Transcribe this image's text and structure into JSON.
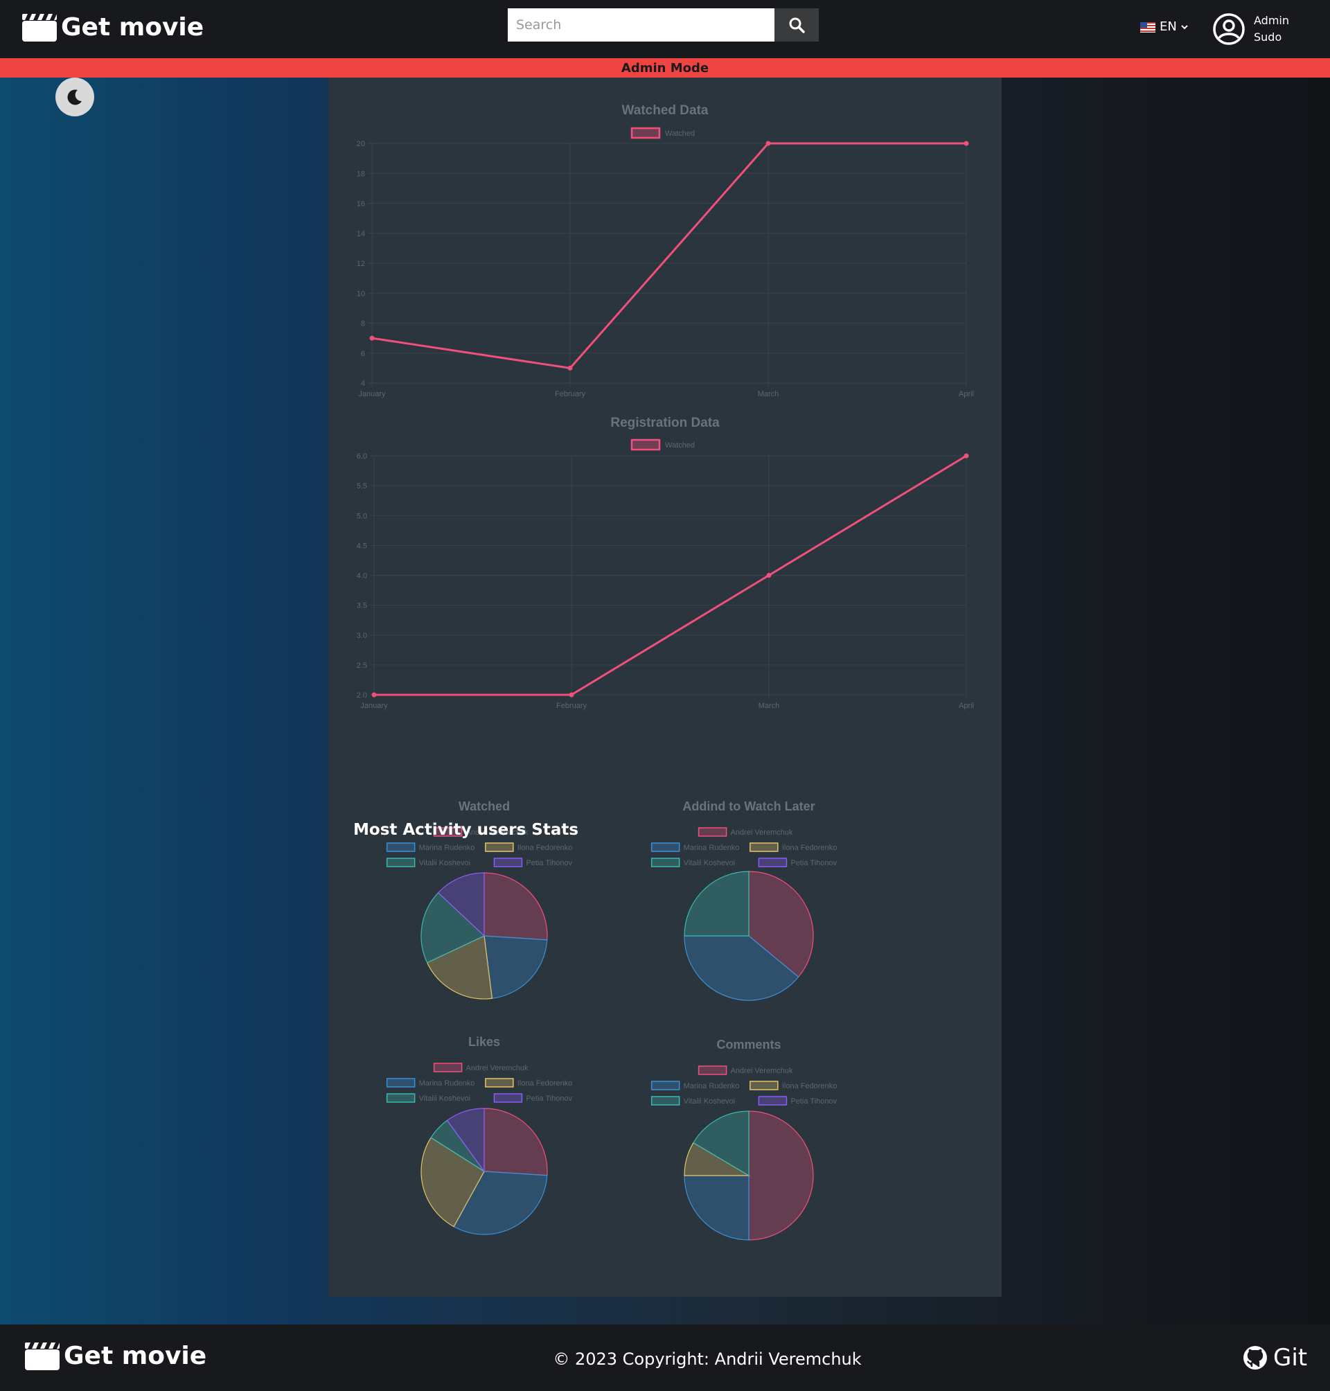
{
  "header": {
    "brand": "Get movie",
    "search_placeholder": "Search",
    "language": "EN",
    "user_first": "Admin",
    "user_second": "Sudo"
  },
  "admin_bar": {
    "label": "Admin Mode"
  },
  "section_title": "Most Activity users Stats",
  "colors": {
    "line": "#f0507a",
    "admin": "#ef4444",
    "pie": [
      "#f0507a",
      "#3b8fd6",
      "#e5c466",
      "#3bb8b0",
      "#8b5cf6"
    ]
  },
  "chart_data": [
    {
      "type": "line",
      "title": "Watched Data",
      "categories": [
        "January",
        "February",
        "March",
        "April"
      ],
      "series": [
        {
          "name": "Watched",
          "values": [
            7,
            5,
            20,
            20
          ]
        }
      ],
      "ylim": [
        4,
        20
      ],
      "yticks": [
        "4",
        "6",
        "8",
        "10",
        "12",
        "14",
        "16",
        "18",
        "20"
      ],
      "grid": true,
      "legend": "top"
    },
    {
      "type": "line",
      "title": "Registration Data",
      "categories": [
        "January",
        "February",
        "March",
        "April"
      ],
      "series": [
        {
          "name": "Watched",
          "values": [
            2,
            2,
            4,
            6
          ]
        }
      ],
      "ylim": [
        2,
        6
      ],
      "yticks": [
        "2.0",
        "2.5",
        "3.0",
        "3.5",
        "4.0",
        "4.5",
        "5.0",
        "5.5",
        "6.0"
      ],
      "grid": true,
      "legend": "top"
    },
    {
      "type": "pie",
      "title": "Watched",
      "labels": [
        "Andrei Veremchuk",
        "Marina Rudenko",
        "Ilona Fedorenko",
        "Vitalii Koshevoi",
        "Petia Tihonov"
      ],
      "values": [
        26,
        22,
        20,
        19,
        13
      ],
      "legend": "top"
    },
    {
      "type": "pie",
      "title": "Addind to Watch Later",
      "labels": [
        "Andrei Veremchuk",
        "Marina Rudenko",
        "Ilona Fedorenko",
        "Vitalii Koshevoi",
        "Petia Tihonov"
      ],
      "values": [
        36,
        39,
        0,
        25,
        0
      ],
      "legend": "top"
    },
    {
      "type": "pie",
      "title": "Likes",
      "labels": [
        "Andrei Veremchuk",
        "Marina Rudenko",
        "Ilona Fedorenko",
        "Vitalii Koshevoi",
        "Petia Tihonov"
      ],
      "values": [
        26,
        32,
        26,
        6,
        10
      ],
      "legend": "top"
    },
    {
      "type": "pie",
      "title": "Comments",
      "labels": [
        "Andrei Veremchuk",
        "Marina Rudenko",
        "Ilona Fedorenko",
        "Vitalii Koshevoi",
        "Petia Tihonov"
      ],
      "values": [
        50,
        25,
        8.5,
        16.5,
        0
      ],
      "legend": "top"
    }
  ],
  "footer": {
    "brand": "Get movie",
    "copyright": "© 2023 Copyright: Andrii Veremchuk",
    "git": "Git"
  }
}
